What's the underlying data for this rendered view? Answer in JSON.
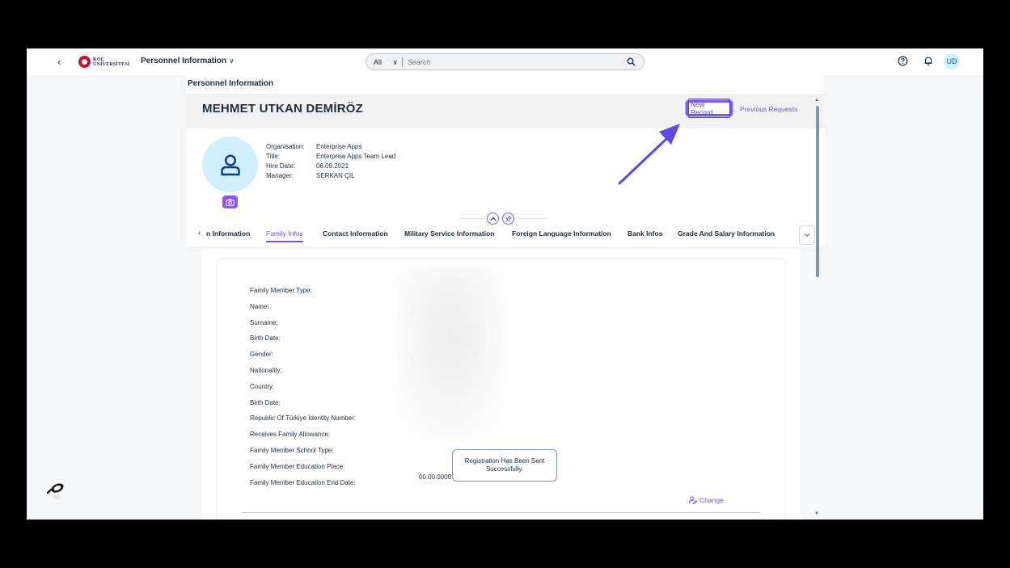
{
  "shell": {
    "logo_line1": "KOÇ",
    "logo_line2": "ÜNİVERSİTESİ",
    "app_title": "Personnel Information",
    "search": {
      "scope": "All",
      "placeholder": "Search"
    },
    "user_initials": "UD"
  },
  "page": {
    "title": "Personnel Information",
    "employee_name": "MEHMET UTKAN DEMİRÖZ",
    "actions": {
      "new_record": "New Record",
      "previous_requests": "Previous Requests"
    },
    "info": [
      {
        "key": "Organisation:",
        "value": "Enterprise Apps"
      },
      {
        "key": "Title:",
        "value": "Enterprise Apps Team Lead"
      },
      {
        "key": "Hire Date:",
        "value": "06.09.2021"
      },
      {
        "key": "Manager:",
        "value": "SERKAN ÇİL"
      }
    ],
    "tabs": [
      {
        "label": "n Information",
        "active": false
      },
      {
        "label": "Family Infos",
        "active": true
      },
      {
        "label": "Contact Information",
        "active": false
      },
      {
        "label": "Military Service Information",
        "active": false
      },
      {
        "label": "Foreign Language Information",
        "active": false
      },
      {
        "label": "Bank Infos",
        "active": false
      },
      {
        "label": "Grade And Salary Information",
        "active": false
      }
    ]
  },
  "family": {
    "fields": [
      "Family Member Type:",
      "Name:",
      "Surname:",
      "Birth Date:",
      "Gender:",
      "Nationality:",
      "Country:",
      "Birth Date:",
      "Republic Of Türkiye Identity Number:",
      "Receives Family Allowance:",
      "Family Member School Type:",
      "Family Member Education Place:",
      "Family Member Education End Date:"
    ],
    "education_end_date_value": "00.00.0000",
    "change_label": "Change"
  },
  "toast": {
    "message": "Registration Has Been Sent Successfully."
  },
  "colors": {
    "accent": "#7b4ff0",
    "avatar_bg": "#d1efff",
    "camera": "#8e52ff"
  }
}
